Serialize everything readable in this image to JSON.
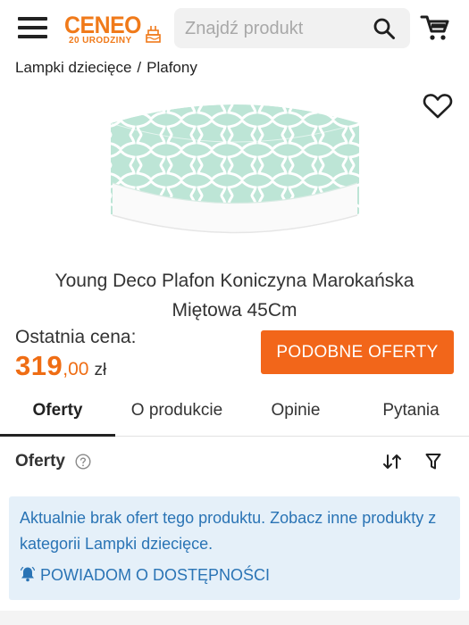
{
  "header": {
    "logo_text": "CENEO",
    "logo_subtext": "20 URODZINY",
    "search_placeholder": "Znajdź produkt",
    "icons": [
      "menu-icon",
      "search-icon",
      "cart-icon"
    ]
  },
  "breadcrumb": {
    "items": [
      "Lampki dziecięce",
      "Plafony"
    ],
    "separator": "/"
  },
  "product": {
    "title": "Young Deco Plafon Koniczyna Marokańska Miętowa 45Cm",
    "last_price_label": "Ostatnia cena:",
    "price_integer": "319",
    "price_decimal": ",00",
    "currency": "zł",
    "similar_offers_button": "PODOBNE OFERTY",
    "favorite_icon": "heart-icon"
  },
  "tabs": [
    {
      "label": "Oferty",
      "active": true
    },
    {
      "label": "O produkcie",
      "active": false
    },
    {
      "label": "Opinie",
      "active": false
    },
    {
      "label": "Pytania",
      "active": false
    }
  ],
  "offers": {
    "title": "Oferty",
    "notice_text": "Aktualnie brak ofert tego produktu. Zobacz inne produkty z kategorii Lampki dziecięce.",
    "notify_label": "POWIADOM O DOSTĘPNOŚCI"
  },
  "colors": {
    "accent": "#f2661a",
    "price": "#ef6d14",
    "notice_bg": "#e5f0f9",
    "notice_text": "#2a74b5",
    "lamp_mint": "#b9e3d3"
  }
}
